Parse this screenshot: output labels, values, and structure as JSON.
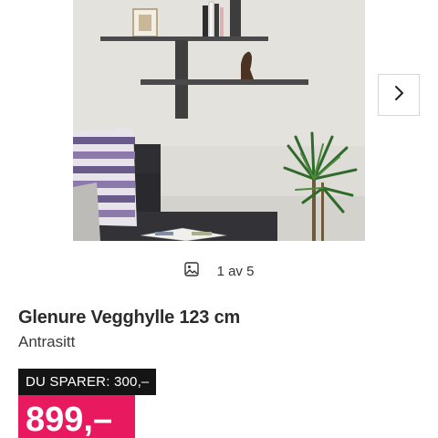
{
  "gallery": {
    "next_icon": "chevron-right-icon",
    "counter_icon": "image-icon",
    "counter_text": "1 av 5"
  },
  "product": {
    "title": "Glenure Vegghylle 123 cm",
    "variant": "Antrasitt"
  },
  "pricing": {
    "saving_label": "DU SPARER: 300,–",
    "price": "899,–",
    "saving_color": "#141414",
    "price_color": "#e8195f"
  }
}
